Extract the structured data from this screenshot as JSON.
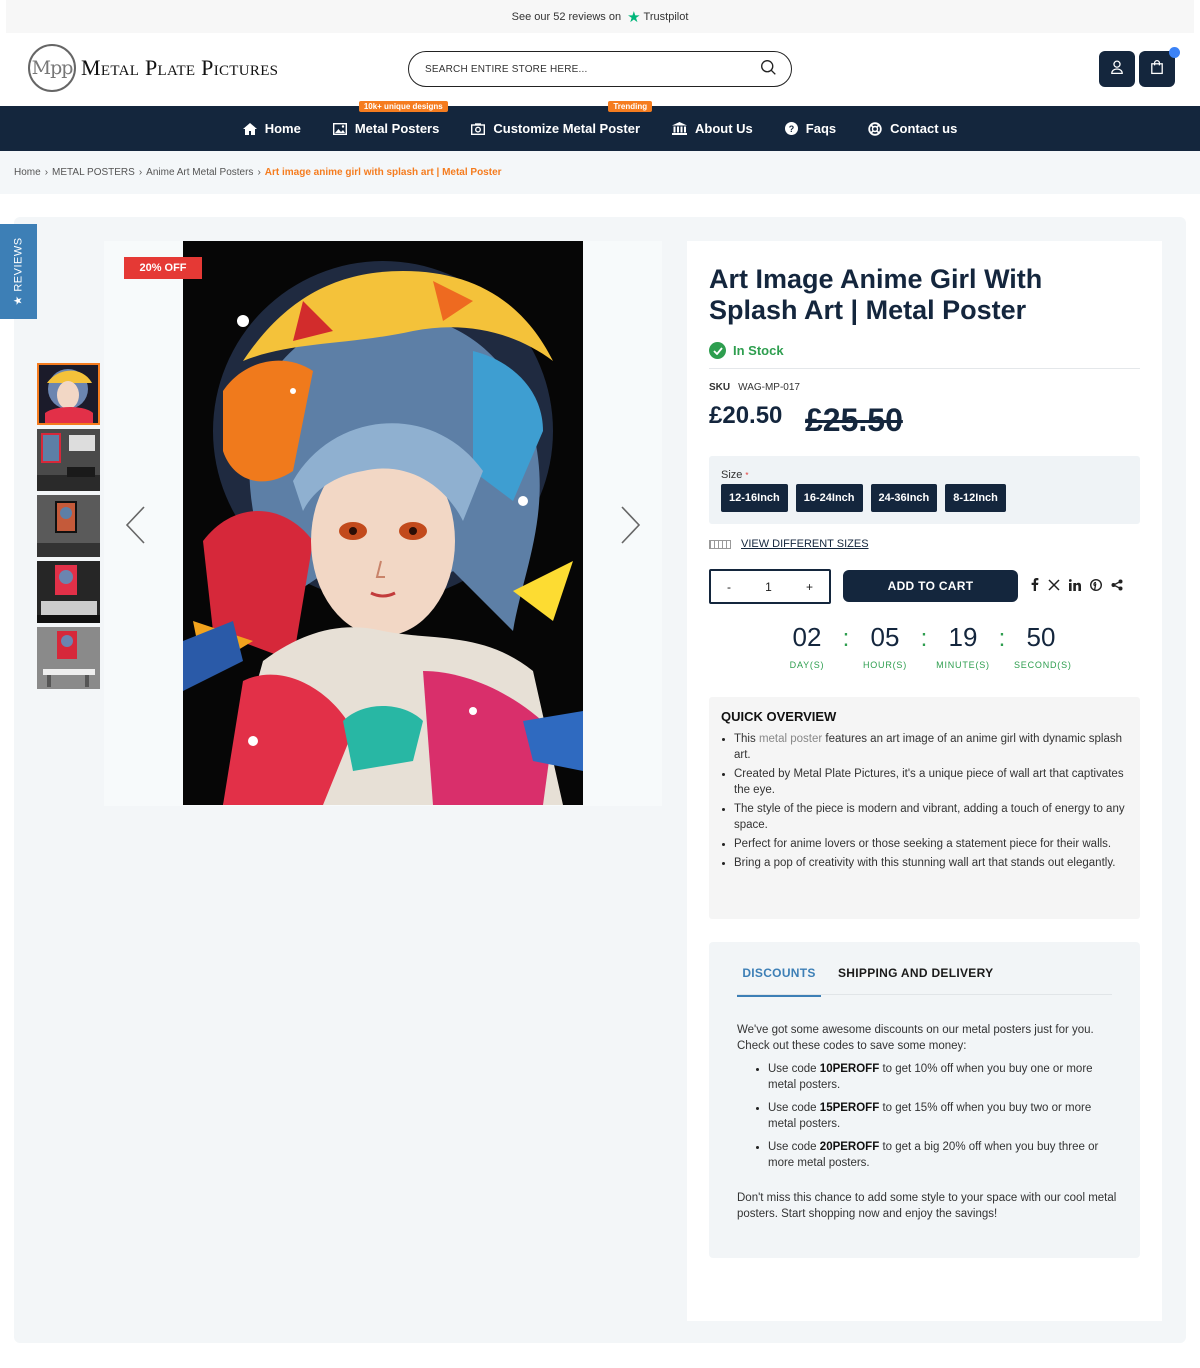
{
  "topbar": {
    "prefix": "See our",
    "count": "52",
    "suffix": "reviews on",
    "brand": "Trustpilot"
  },
  "header": {
    "logo_mark": "Mpp",
    "logo_text": "Metal Plate Pictures",
    "search_placeholder": "SEARCH ENTIRE STORE HERE..."
  },
  "nav": {
    "items": [
      {
        "label": "Home",
        "icon": "home-icon"
      },
      {
        "label": "Metal Posters",
        "icon": "image-icon",
        "tag": "10k+ unique designs"
      },
      {
        "label": "Customize Metal Poster",
        "icon": "camera-icon",
        "tag": "Trending"
      },
      {
        "label": "About Us",
        "icon": "bank-icon"
      },
      {
        "label": "Faqs",
        "icon": "question-icon"
      },
      {
        "label": "Contact us",
        "icon": "lifebuoy-icon"
      }
    ]
  },
  "breadcrumb": [
    "Home",
    "METAL POSTERS",
    "Anime Art Metal Posters",
    "Art image anime girl with splash art | Metal Poster"
  ],
  "reviews_tab": "★ REVIEWS",
  "product": {
    "badge": "20% OFF",
    "title": "Art Image Anime Girl With Splash Art | Metal Poster",
    "stock": "In Stock",
    "sku_label": "SKU",
    "sku": "WAG-MP-017",
    "price": "£20.50",
    "old_price": "£25.50",
    "size_label": "Size",
    "sizes": [
      "12-16Inch",
      "16-24Inch",
      "24-36Inch",
      "8-12Inch"
    ],
    "view_sizes": "VIEW DIFFERENT SIZES",
    "qty_minus": "-",
    "qty": "1",
    "qty_plus": "+",
    "add_to_cart": "ADD TO CART"
  },
  "countdown": [
    {
      "value": "02",
      "label": "DAY(S)"
    },
    {
      "value": "05",
      "label": "HOUR(S)"
    },
    {
      "value": "19",
      "label": "MINUTE(S)"
    },
    {
      "value": "50",
      "label": "SECOND(S)"
    }
  ],
  "overview": {
    "title": "QUICK OVERVIEW",
    "first_prefix": "This",
    "first_link": "metal poster",
    "first_suffix": "features an art image of an anime girl with dynamic splash art.",
    "items": [
      "Created by Metal Plate Pictures, it's a unique piece of wall art that captivates the eye.",
      "The style of the piece is modern and vibrant, adding a touch of energy to any space.",
      "Perfect for anime lovers or those seeking a statement piece for their walls.",
      "Bring a pop of creativity with this stunning wall art that stands out elegantly."
    ]
  },
  "tabs": {
    "discounts": "DISCOUNTS",
    "shipping": "SHIPPING AND DELIVERY",
    "intro": "We've got some awesome discounts on our metal posters just for you. Check out these codes to save some money:",
    "codes": [
      {
        "pre": "Use code",
        "code": "10PEROFF",
        "post": "to get 10% off when you buy one or more metal posters."
      },
      {
        "pre": "Use code",
        "code": "15PEROFF",
        "post": "to get 15% off when you buy two or more metal posters."
      },
      {
        "pre": "Use code",
        "code": "20PEROFF",
        "post": "to get a big 20% off when you buy three or more metal posters."
      }
    ],
    "outro": "Don't miss this chance to add some style to your space with our cool metal posters. Start shopping now and enjoy the savings!"
  },
  "colors": {
    "navy": "#14263d",
    "orange": "#f57c1f",
    "green": "#2e9e4f",
    "blue": "#3d7fb6",
    "sale_red": "#e53935"
  }
}
